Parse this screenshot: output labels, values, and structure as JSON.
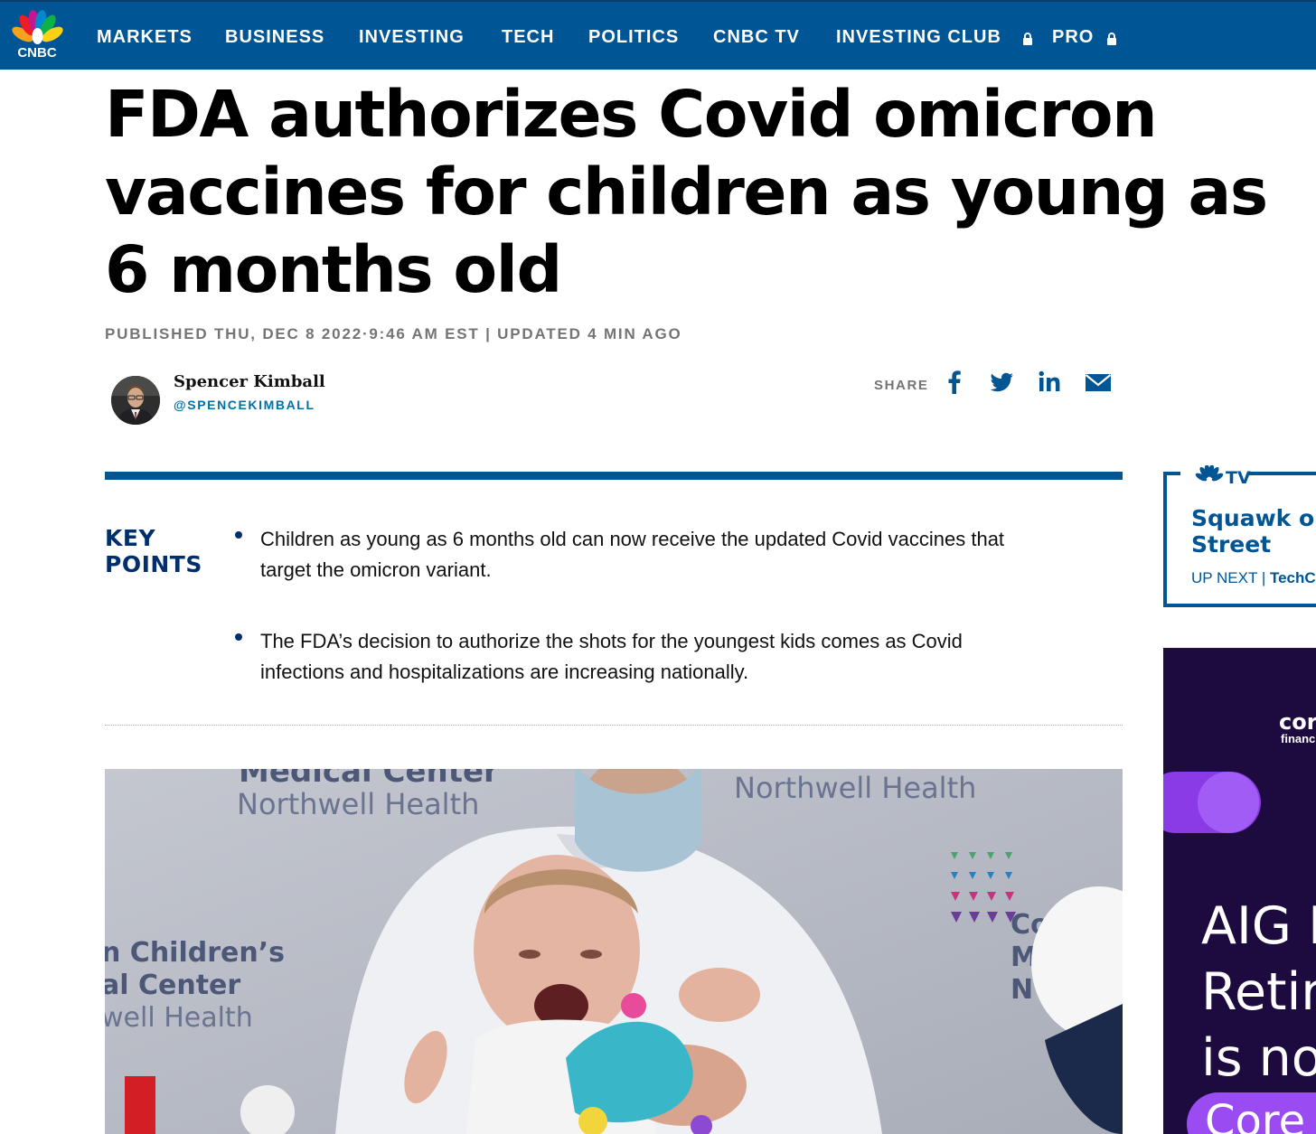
{
  "nav": {
    "logo_text": "CNBC",
    "items": [
      "MARKETS",
      "BUSINESS",
      "INVESTING",
      "TECH",
      "POLITICS",
      "CNBC TV",
      "INVESTING CLUB",
      "PRO"
    ],
    "colors": {
      "bar": "#005594",
      "text": "#ffffff"
    }
  },
  "article": {
    "headline": "FDA authorizes Covid omicron vaccines for children as young as 6 months old",
    "dateline": "PUBLISHED THU, DEC 8 2022·9:46 AM EST | UPDATED 4 MIN AGO",
    "author": {
      "name": "Spencer Kimball",
      "handle": "@SPENCEKIMBALL"
    },
    "share": {
      "label": "SHARE",
      "icons": [
        "facebook-icon",
        "twitter-icon",
        "linkedin-icon",
        "email-icon"
      ]
    },
    "key_points": {
      "title": "KEY POINTS",
      "items": [
        "Children as young as 6 months old can now receive the updated Covid vaccines that target the omicron variant.",
        "The FDA’s decision to authorize the shots for the youngest kids comes as Covid infections and hospitalizations are increasing nationally."
      ]
    },
    "photo": {
      "sign_left_top": "Medical Center",
      "sign_left": "Northwell Health",
      "sign_right": "Northwell Health",
      "sign_left_edge": [
        "n Children’s",
        "al Center",
        "well Health"
      ],
      "sign_right_edge": [
        "Co",
        "M",
        "N"
      ]
    }
  },
  "rail": {
    "tv": {
      "badge": "TV",
      "show": [
        "Squawk o",
        "Street"
      ],
      "up_next_label": "UP NEXT",
      "up_next_show": "TechC"
    },
    "ad": {
      "brand": [
        "cor",
        "financ"
      ],
      "headline": [
        "AIG I",
        "Retir",
        "is no"
      ],
      "cta": "Core"
    }
  },
  "colors": {
    "accent": "#005594",
    "key_points": "#002f6c",
    "meta": "#747474",
    "handle": "#0071a4"
  }
}
